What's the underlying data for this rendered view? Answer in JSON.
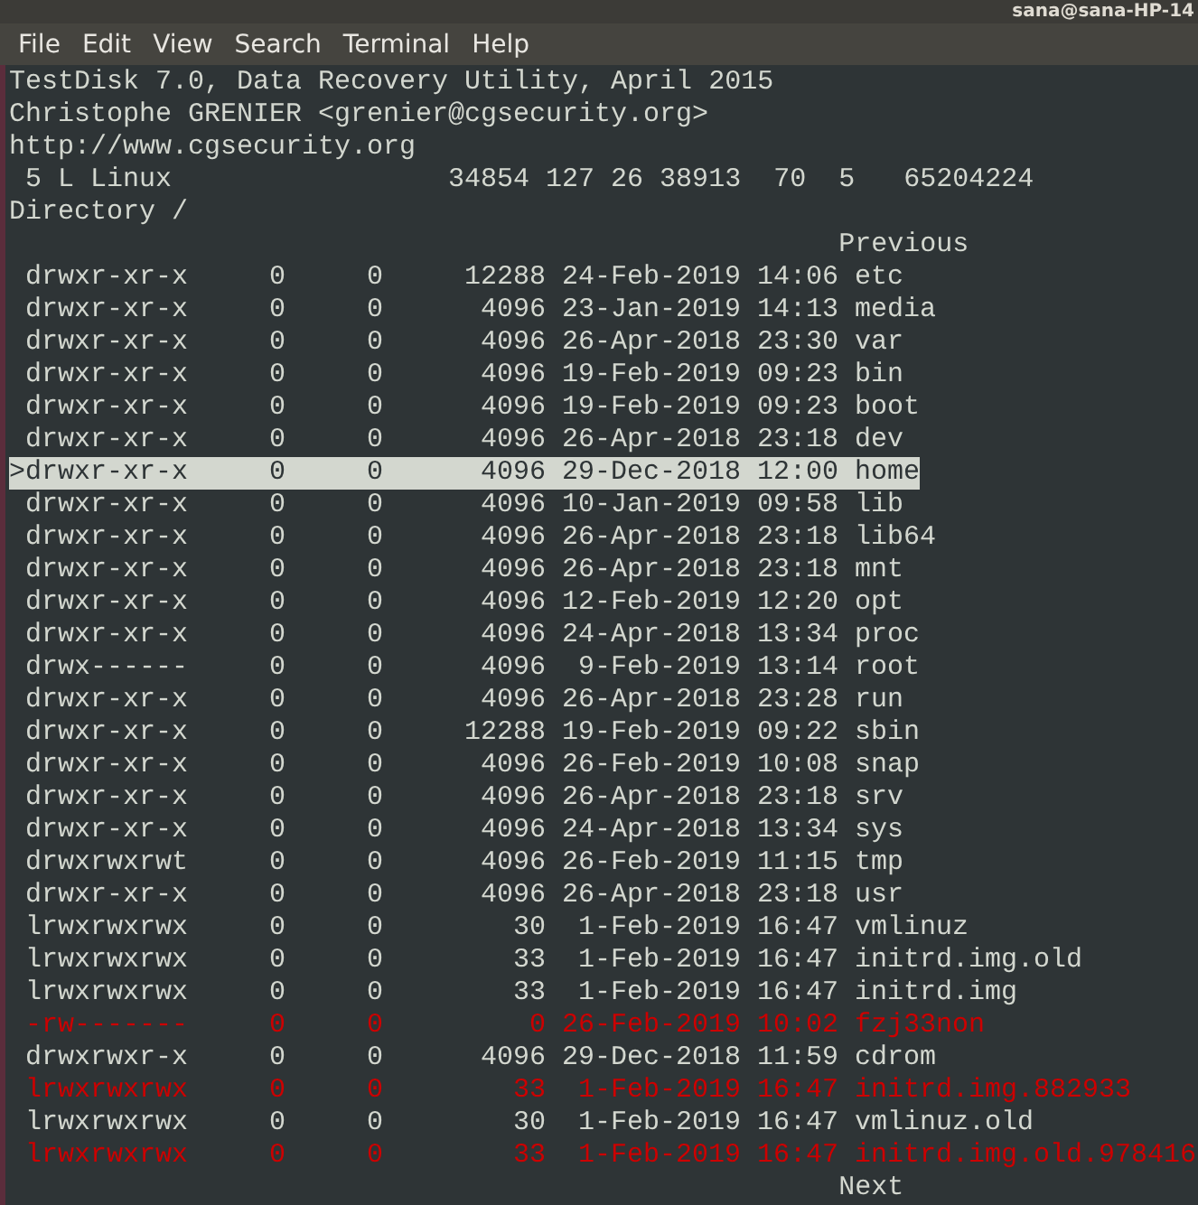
{
  "window": {
    "title": "sana@sana-HP-14"
  },
  "menu": [
    "File",
    "Edit",
    "View",
    "Search",
    "Terminal",
    "Help"
  ],
  "header": [
    "TestDisk 7.0, Data Recovery Utility, April 2015",
    "Christophe GRENIER <grenier@cgsecurity.org>",
    "http://www.cgsecurity.org",
    " 5 L Linux                 34854 127 26 38913  70  5   65204224",
    "Directory /"
  ],
  "previous": "Previous",
  "rows": [
    {
      "perms": "drwxr-xr-x",
      "uid": "0",
      "gid": "0",
      "size": "12288",
      "date": "24-Feb-2019",
      "time": "14:06",
      "name": "etc",
      "selected": false,
      "deleted": false
    },
    {
      "perms": "drwxr-xr-x",
      "uid": "0",
      "gid": "0",
      "size": "4096",
      "date": "23-Jan-2019",
      "time": "14:13",
      "name": "media",
      "selected": false,
      "deleted": false
    },
    {
      "perms": "drwxr-xr-x",
      "uid": "0",
      "gid": "0",
      "size": "4096",
      "date": "26-Apr-2018",
      "time": "23:30",
      "name": "var",
      "selected": false,
      "deleted": false
    },
    {
      "perms": "drwxr-xr-x",
      "uid": "0",
      "gid": "0",
      "size": "4096",
      "date": "19-Feb-2019",
      "time": "09:23",
      "name": "bin",
      "selected": false,
      "deleted": false
    },
    {
      "perms": "drwxr-xr-x",
      "uid": "0",
      "gid": "0",
      "size": "4096",
      "date": "19-Feb-2019",
      "time": "09:23",
      "name": "boot",
      "selected": false,
      "deleted": false
    },
    {
      "perms": "drwxr-xr-x",
      "uid": "0",
      "gid": "0",
      "size": "4096",
      "date": "26-Apr-2018",
      "time": "23:18",
      "name": "dev",
      "selected": false,
      "deleted": false
    },
    {
      "cursor": ">",
      "perms": "drwxr-xr-x",
      "uid": "0",
      "gid": "0",
      "size": "4096",
      "date": "29-Dec-2018",
      "time": "12:00",
      "name": "home",
      "selected": true,
      "deleted": false
    },
    {
      "perms": "drwxr-xr-x",
      "uid": "0",
      "gid": "0",
      "size": "4096",
      "date": "10-Jan-2019",
      "time": "09:58",
      "name": "lib",
      "selected": false,
      "deleted": false
    },
    {
      "perms": "drwxr-xr-x",
      "uid": "0",
      "gid": "0",
      "size": "4096",
      "date": "26-Apr-2018",
      "time": "23:18",
      "name": "lib64",
      "selected": false,
      "deleted": false
    },
    {
      "perms": "drwxr-xr-x",
      "uid": "0",
      "gid": "0",
      "size": "4096",
      "date": "26-Apr-2018",
      "time": "23:18",
      "name": "mnt",
      "selected": false,
      "deleted": false
    },
    {
      "perms": "drwxr-xr-x",
      "uid": "0",
      "gid": "0",
      "size": "4096",
      "date": "12-Feb-2019",
      "time": "12:20",
      "name": "opt",
      "selected": false,
      "deleted": false
    },
    {
      "perms": "drwxr-xr-x",
      "uid": "0",
      "gid": "0",
      "size": "4096",
      "date": "24-Apr-2018",
      "time": "13:34",
      "name": "proc",
      "selected": false,
      "deleted": false
    },
    {
      "perms": "drwx------",
      "uid": "0",
      "gid": "0",
      "size": "4096",
      "date": "9-Feb-2019",
      "time": "13:14",
      "name": "root",
      "selected": false,
      "deleted": false
    },
    {
      "perms": "drwxr-xr-x",
      "uid": "0",
      "gid": "0",
      "size": "4096",
      "date": "26-Apr-2018",
      "time": "23:28",
      "name": "run",
      "selected": false,
      "deleted": false
    },
    {
      "perms": "drwxr-xr-x",
      "uid": "0",
      "gid": "0",
      "size": "12288",
      "date": "19-Feb-2019",
      "time": "09:22",
      "name": "sbin",
      "selected": false,
      "deleted": false
    },
    {
      "perms": "drwxr-xr-x",
      "uid": "0",
      "gid": "0",
      "size": "4096",
      "date": "26-Feb-2019",
      "time": "10:08",
      "name": "snap",
      "selected": false,
      "deleted": false
    },
    {
      "perms": "drwxr-xr-x",
      "uid": "0",
      "gid": "0",
      "size": "4096",
      "date": "26-Apr-2018",
      "time": "23:18",
      "name": "srv",
      "selected": false,
      "deleted": false
    },
    {
      "perms": "drwxr-xr-x",
      "uid": "0",
      "gid": "0",
      "size": "4096",
      "date": "24-Apr-2018",
      "time": "13:34",
      "name": "sys",
      "selected": false,
      "deleted": false
    },
    {
      "perms": "drwxrwxrwt",
      "uid": "0",
      "gid": "0",
      "size": "4096",
      "date": "26-Feb-2019",
      "time": "11:15",
      "name": "tmp",
      "selected": false,
      "deleted": false
    },
    {
      "perms": "drwxr-xr-x",
      "uid": "0",
      "gid": "0",
      "size": "4096",
      "date": "26-Apr-2018",
      "time": "23:18",
      "name": "usr",
      "selected": false,
      "deleted": false
    },
    {
      "perms": "lrwxrwxrwx",
      "uid": "0",
      "gid": "0",
      "size": "30",
      "date": "1-Feb-2019",
      "time": "16:47",
      "name": "vmlinuz",
      "selected": false,
      "deleted": false
    },
    {
      "perms": "lrwxrwxrwx",
      "uid": "0",
      "gid": "0",
      "size": "33",
      "date": "1-Feb-2019",
      "time": "16:47",
      "name": "initrd.img.old",
      "selected": false,
      "deleted": false
    },
    {
      "perms": "lrwxrwxrwx",
      "uid": "0",
      "gid": "0",
      "size": "33",
      "date": "1-Feb-2019",
      "time": "16:47",
      "name": "initrd.img",
      "selected": false,
      "deleted": false
    },
    {
      "perms": "-rw-------",
      "uid": "0",
      "gid": "0",
      "size": "0",
      "date": "26-Feb-2019",
      "time": "10:02",
      "name": "fzj33non",
      "selected": false,
      "deleted": true
    },
    {
      "perms": "drwxrwxr-x",
      "uid": "0",
      "gid": "0",
      "size": "4096",
      "date": "29-Dec-2018",
      "time": "11:59",
      "name": "cdrom",
      "selected": false,
      "deleted": false
    },
    {
      "perms": "lrwxrwxrwx",
      "uid": "0",
      "gid": "0",
      "size": "33",
      "date": "1-Feb-2019",
      "time": "16:47",
      "name": "initrd.img.882933",
      "selected": false,
      "deleted": true
    },
    {
      "perms": "lrwxrwxrwx",
      "uid": "0",
      "gid": "0",
      "size": "30",
      "date": "1-Feb-2019",
      "time": "16:47",
      "name": "vmlinuz.old",
      "selected": false,
      "deleted": false
    },
    {
      "perms": "lrwxrwxrwx",
      "uid": "0",
      "gid": "0",
      "size": "33",
      "date": "1-Feb-2019",
      "time": "16:47",
      "name": "initrd.img.old.978416",
      "selected": false,
      "deleted": true
    }
  ],
  "next": "Next"
}
